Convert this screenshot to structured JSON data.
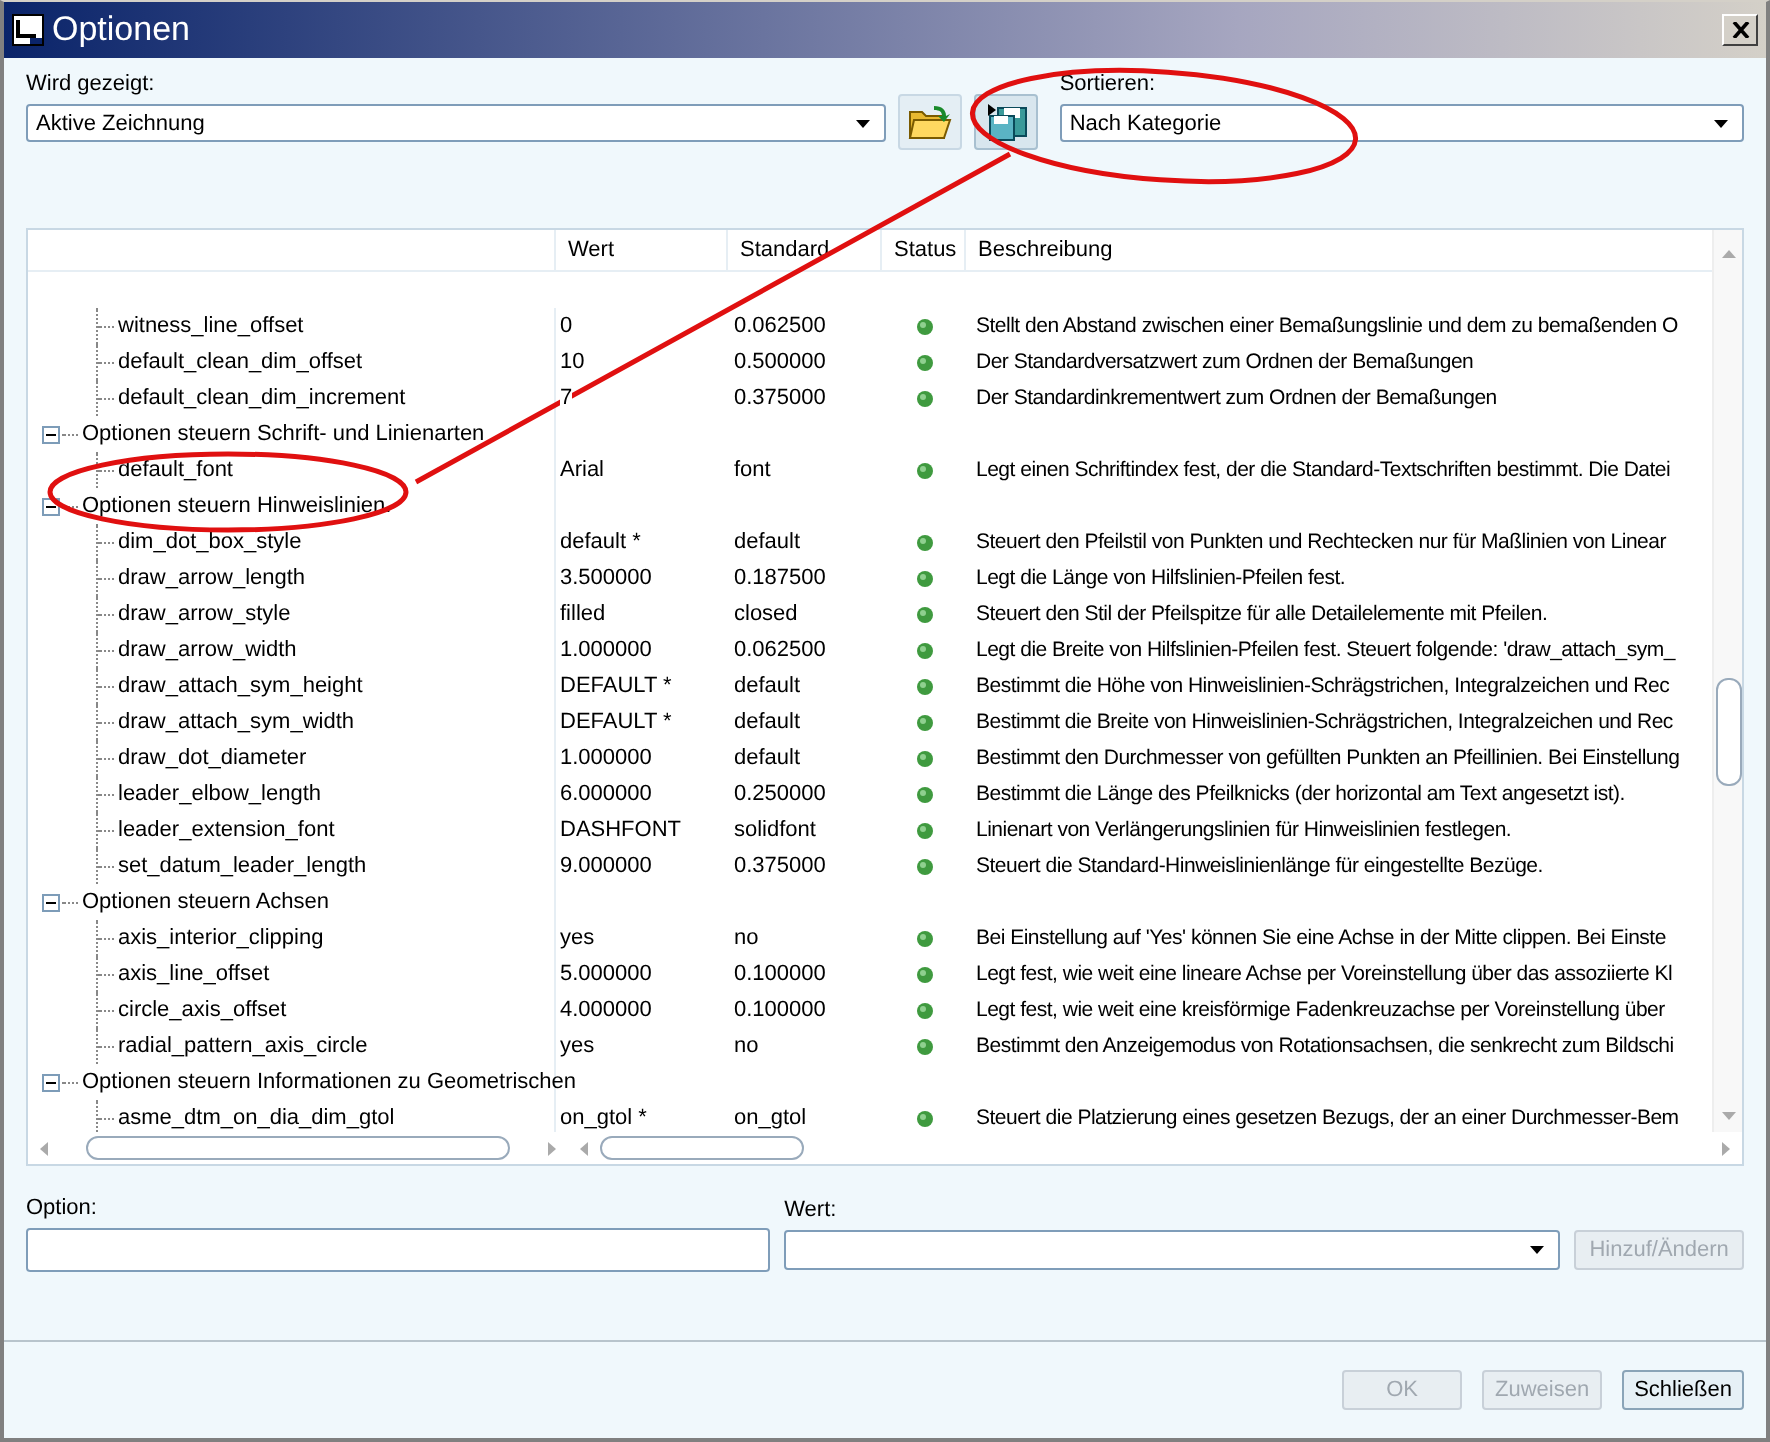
{
  "window": {
    "title": "Optionen"
  },
  "shown": {
    "label": "Wird gezeigt:",
    "value": "Aktive Zeichnung"
  },
  "sort": {
    "label": "Sortieren:",
    "value": "Nach Kategorie"
  },
  "table": {
    "columns": [
      "Wert",
      "Standard",
      "Status",
      "Beschreibung"
    ],
    "groups": [
      {
        "children": [
          {
            "name": "witness_line_offset",
            "value": "0",
            "default": "0.062500",
            "description": "Stellt den Abstand zwischen einer Bemaßungslinie und dem zu bemaßenden O"
          },
          {
            "name": "default_clean_dim_offset",
            "value": "10",
            "default": "0.500000",
            "description": "Der Standardversatzwert zum Ordnen der Bemaßungen"
          },
          {
            "name": "default_clean_dim_increment",
            "value": "7",
            "default": "0.375000",
            "description": "Der Standardinkrementwert zum Ordnen der Bemaßungen"
          }
        ]
      },
      {
        "label": "Optionen steuern Schrift- und Linienarten",
        "expanded": true,
        "children": [
          {
            "name": "default_font",
            "value": "Arial",
            "default": "font",
            "description": "Legt einen Schriftindex fest, der die Standard-Textschriften bestimmt. Die Datei"
          }
        ]
      },
      {
        "label": "Optionen steuern Hinweislinien.",
        "expanded": true,
        "children": [
          {
            "name": "dim_dot_box_style",
            "value": "default *",
            "default": "default",
            "description": "Steuert den Pfeilstil von Punkten und Rechtecken nur für Maßlinien von Linear"
          },
          {
            "name": "draw_arrow_length",
            "value": "3.500000",
            "default": "0.187500",
            "description": "Legt die Länge von Hilfslinien-Pfeilen fest."
          },
          {
            "name": "draw_arrow_style",
            "value": "filled",
            "default": "closed",
            "description": "Steuert den Stil der Pfeilspitze für alle Detailelemente mit Pfeilen."
          },
          {
            "name": "draw_arrow_width",
            "value": "1.000000",
            "default": "0.062500",
            "description": "Legt die Breite von Hilfslinien-Pfeilen fest. Steuert folgende: 'draw_attach_sym_"
          },
          {
            "name": "draw_attach_sym_height",
            "value": "DEFAULT *",
            "default": "default",
            "description": "Bestimmt die Höhe von Hinweislinien-Schrägstrichen, Integralzeichen und Rec"
          },
          {
            "name": "draw_attach_sym_width",
            "value": "DEFAULT *",
            "default": "default",
            "description": "Bestimmt die Breite von Hinweislinien-Schrägstrichen, Integralzeichen und Rec"
          },
          {
            "name": "draw_dot_diameter",
            "value": "1.000000",
            "default": "default",
            "description": "Bestimmt den Durchmesser von gefüllten Punkten an Pfeillinien. Bei Einstellung"
          },
          {
            "name": "leader_elbow_length",
            "value": "6.000000",
            "default": "0.250000",
            "description": "Bestimmt die Länge des Pfeilknicks (der horizontal am Text angesetzt ist)."
          },
          {
            "name": "leader_extension_font",
            "value": "DASHFONT",
            "default": "solidfont",
            "description": "Linienart von Verlängerungslinien für Hinweislinien festlegen."
          },
          {
            "name": "set_datum_leader_length",
            "value": "9.000000",
            "default": "0.375000",
            "description": "Steuert die Standard-Hinweislinienlänge für eingestellte Bezüge."
          }
        ]
      },
      {
        "label": "Optionen steuern Achsen",
        "expanded": true,
        "children": [
          {
            "name": "axis_interior_clipping",
            "value": "yes",
            "default": "no",
            "description": "Bei Einstellung auf 'Yes' können Sie eine Achse in der Mitte clippen. Bei Einste"
          },
          {
            "name": "axis_line_offset",
            "value": "5.000000",
            "default": "0.100000",
            "description": "Legt fest, wie weit eine lineare Achse per Voreinstellung über das assoziierte Kl"
          },
          {
            "name": "circle_axis_offset",
            "value": "4.000000",
            "default": "0.100000",
            "description": "Legt fest, wie weit eine kreisförmige Fadenkreuzachse per Voreinstellung über"
          },
          {
            "name": "radial_pattern_axis_circle",
            "value": "yes",
            "default": "no",
            "description": "Bestimmt den Anzeigemodus von Rotationsachsen, die senkrecht zum Bildschi"
          }
        ]
      },
      {
        "label": "Optionen steuern Informationen zu Geometrischen",
        "expanded": true,
        "children": [
          {
            "name": "asme_dtm_on_dia_dim_gtol",
            "value": "on_gtol *",
            "default": "on_gtol",
            "description": "Steuert die Platzierung eines gesetzen Bezugs, der an einer Durchmesser-Bem"
          }
        ]
      }
    ]
  },
  "option_field": {
    "label": "Option:"
  },
  "value_field": {
    "label": "Wert:"
  },
  "apply_button": {
    "label": "Hinzuf/Ändern",
    "disabled": true
  },
  "footer_buttons": [
    {
      "label": "OK",
      "disabled": true
    },
    {
      "label": "Zuweisen",
      "disabled": true
    },
    {
      "label": "Schließen",
      "disabled": false
    }
  ]
}
